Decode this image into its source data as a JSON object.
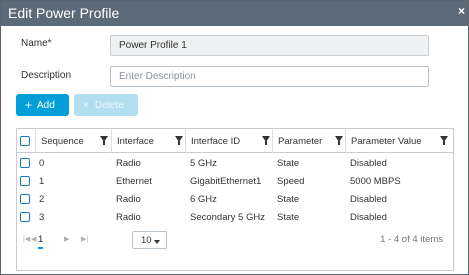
{
  "dialog": {
    "title": "Edit Power Profile",
    "close_glyph": "×"
  },
  "form": {
    "name_label": "Name*",
    "name_value": "Power Profile 1",
    "description_label": "Description",
    "description_placeholder": "Enter Description"
  },
  "toolbar": {
    "add_label": "Add",
    "delete_label": "Delete",
    "add_glyph": "+",
    "delete_glyph": "×"
  },
  "table": {
    "columns": [
      "Sequence",
      "Interface",
      "Interface ID",
      "Parameter",
      "Parameter Value"
    ],
    "rows": [
      [
        "0",
        "Radio",
        "5 GHz",
        "State",
        "Disabled"
      ],
      [
        "1",
        "Ethernet",
        "GigabitEthernet1",
        "Speed",
        "5000 MBPS"
      ],
      [
        "2",
        "Radio",
        "6 GHz",
        "State",
        "Disabled"
      ],
      [
        "3",
        "Radio",
        "Secondary 5 GHz",
        "State",
        "Disabled"
      ]
    ]
  },
  "pager": {
    "first_glyph": "|◀",
    "prev_glyph": "◀",
    "current_page": "1",
    "next_glyph": "▶",
    "last_glyph": "▶|",
    "page_size": "10",
    "info": "1 - 4 of 4 items"
  },
  "colors": {
    "title_bar": "#5b6a79",
    "primary": "#049fd9",
    "checkbox": "#1f77c9"
  },
  "icons": {
    "close": "close-icon",
    "add": "plus-icon",
    "delete": "x-icon",
    "filter": "filter-icon",
    "checkbox": "checkbox-icon"
  }
}
